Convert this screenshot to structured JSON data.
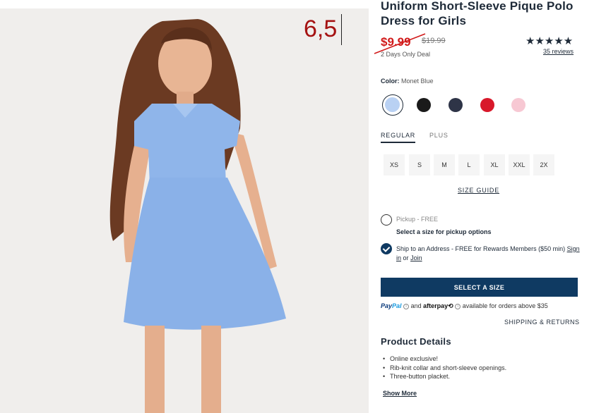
{
  "annotation": {
    "text": "6,5"
  },
  "product": {
    "title": "Uniform Short-Sleeve Pique Polo Dress for Girls",
    "sale_price": "$9.99",
    "original_price": "$19.99",
    "deal_text": "2 Days Only Deal",
    "rating_stars": "★★★★★",
    "rating_value": 5,
    "reviews_link": "35 reviews"
  },
  "color": {
    "label": "Color:",
    "selected_name": "Monet Blue",
    "swatches": [
      {
        "name": "Monet Blue",
        "hex": "#b9d1f3",
        "selected": true
      },
      {
        "name": "Black",
        "hex": "#1a1a1a",
        "selected": false
      },
      {
        "name": "Navy",
        "hex": "#2e3447",
        "selected": false
      },
      {
        "name": "Red",
        "hex": "#d8182a",
        "selected": false
      },
      {
        "name": "Pink",
        "hex": "#f7c8d3",
        "selected": false
      }
    ]
  },
  "fit_tabs": [
    {
      "label": "REGULAR",
      "active": true
    },
    {
      "label": "PLUS",
      "active": false
    }
  ],
  "sizes": [
    "XS",
    "S",
    "M",
    "L",
    "XL",
    "XXL",
    "2X"
  ],
  "size_guide": "SIZE GUIDE",
  "fulfillment": {
    "pickup_label": "Pickup - FREE",
    "pickup_sub": "Select a size for pickup options",
    "ship_text": "Ship to an Address - FREE for Rewards Members ($50 min)",
    "sign_in": "Sign in",
    "or": "or",
    "join": "Join"
  },
  "cta": {
    "label": "SELECT A SIZE"
  },
  "payment": {
    "paypal_a": "Pay",
    "paypal_b": "Pal",
    "and": "and",
    "afterpay": "afterpay",
    "afterpay_mark": "⟲",
    "info": "i",
    "note": "available for orders above $35"
  },
  "shipping_returns": "SHIPPING & RETURNS",
  "details": {
    "title": "Product Details",
    "items": [
      "Online exclusive!",
      "Rib-knit collar and short-sleeve openings.",
      "Three-button placket."
    ],
    "show_more": "Show More"
  },
  "colors": {
    "brand_navy": "#0f3a62",
    "sale_red": "#d11a1a",
    "text": "#1e2a38"
  }
}
